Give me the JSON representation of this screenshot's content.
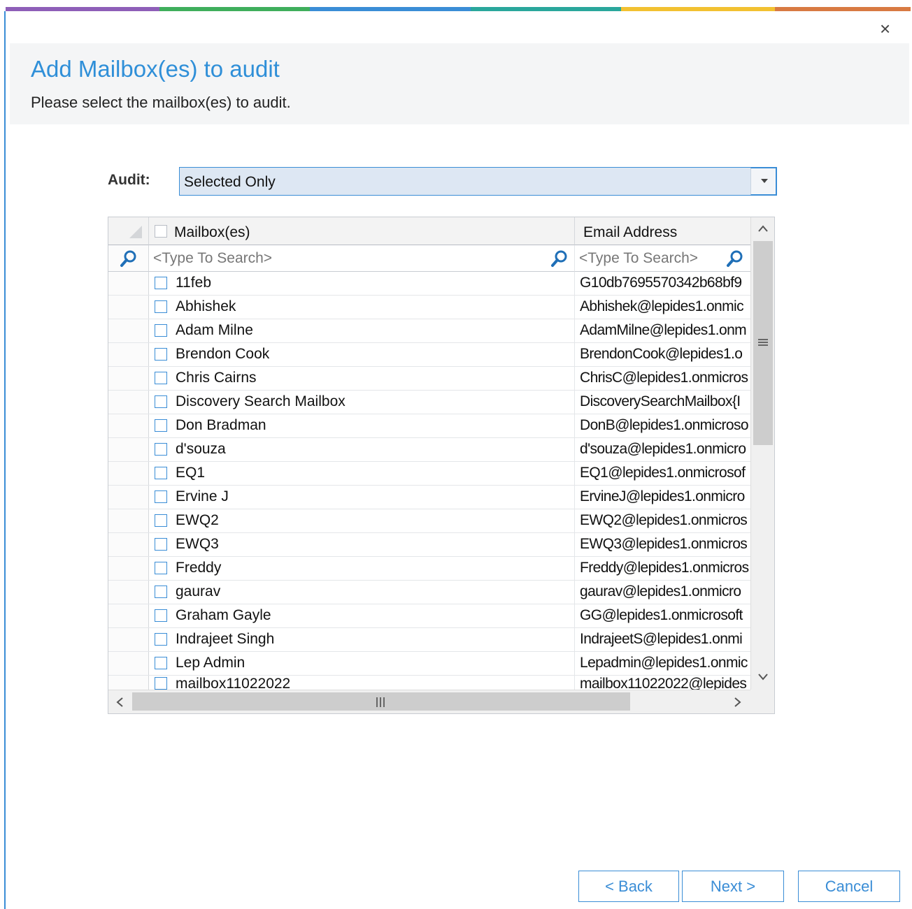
{
  "window": {
    "close_glyph": "×"
  },
  "accent_colors": [
    "#8e5fb8",
    "#3fae5c",
    "#3a8dd6",
    "#2aa79c",
    "#f2c131",
    "#d87a42"
  ],
  "header": {
    "title": "Add Mailbox(es) to audit",
    "subtitle": "Please select the mailbox(es) to audit."
  },
  "audit": {
    "label": "Audit:",
    "selected": "Selected Only"
  },
  "grid": {
    "columns": {
      "mailbox": "Mailbox(es)",
      "email": "Email Address"
    },
    "search_placeholder": {
      "mailbox": "<Type To Search>",
      "email": "<Type To Search>"
    },
    "rows": [
      {
        "name": "11feb",
        "email": "G10db7695570342b68bf9"
      },
      {
        "name": "Abhishek",
        "email": "Abhishek@lepides1.onmic"
      },
      {
        "name": "Adam Milne",
        "email": "AdamMilne@lepides1.onm"
      },
      {
        "name": "Brendon Cook",
        "email": "BrendonCook@lepides1.o"
      },
      {
        "name": "Chris Cairns",
        "email": "ChrisC@lepides1.onmicros"
      },
      {
        "name": "Discovery Search Mailbox",
        "email": "DiscoverySearchMailbox{I"
      },
      {
        "name": "Don Bradman",
        "email": "DonB@lepides1.onmicroso"
      },
      {
        "name": "d'souza",
        "email": "d'souza@lepides1.onmicro"
      },
      {
        "name": "EQ1",
        "email": "EQ1@lepides1.onmicrosof"
      },
      {
        "name": "Ervine J",
        "email": "ErvineJ@lepides1.onmicro"
      },
      {
        "name": "EWQ2",
        "email": "EWQ2@lepides1.onmicros"
      },
      {
        "name": "EWQ3",
        "email": "EWQ3@lepides1.onmicros"
      },
      {
        "name": "Freddy",
        "email": "Freddy@lepides1.onmicros"
      },
      {
        "name": "gaurav",
        "email": "gaurav@lepides1.onmicro"
      },
      {
        "name": "Graham Gayle",
        "email": "GG@lepides1.onmicrosoft"
      },
      {
        "name": "Indrajeet Singh",
        "email": "IndrajeetS@lepides1.onmi"
      },
      {
        "name": "Lep Admin",
        "email": "Lepadmin@lepides1.onmic"
      },
      {
        "name": "mailbox11022022",
        "email": "mailbox11022022@lepides"
      }
    ]
  },
  "buttons": {
    "back": "< Back",
    "next": "Next >",
    "cancel": "Cancel"
  }
}
